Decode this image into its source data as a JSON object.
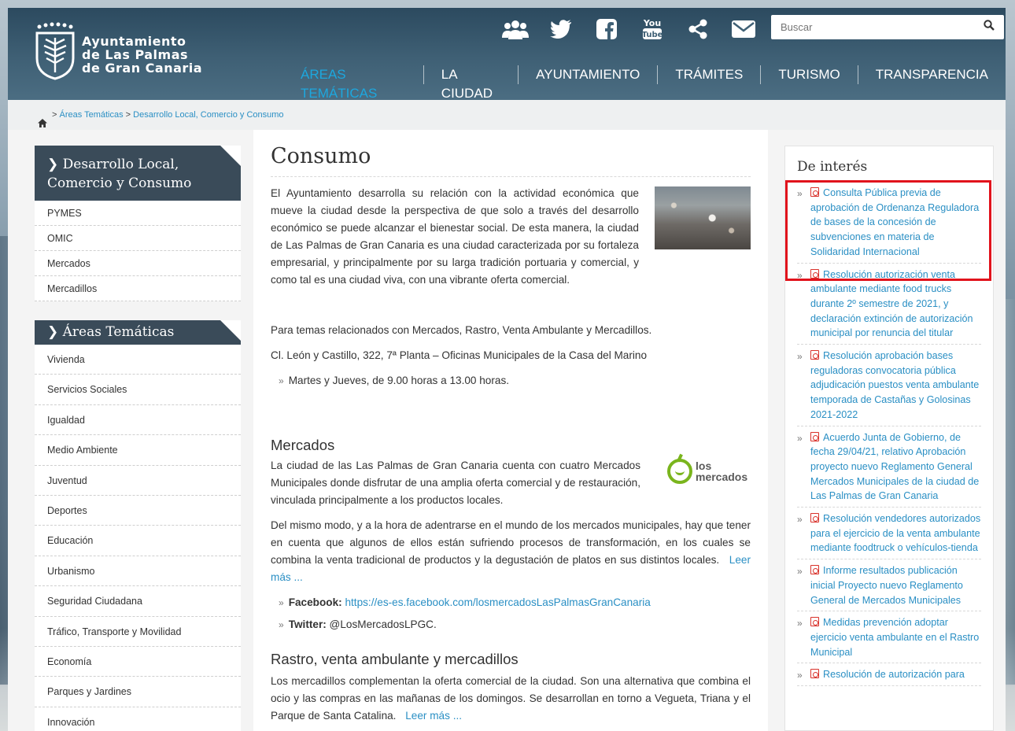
{
  "logo": {
    "lines": [
      "Ayuntamiento",
      "de Las Palmas",
      "de Gran Canaria"
    ]
  },
  "social_icons": [
    "people-icon",
    "twitter-icon",
    "facebook-icon",
    "youtube-icon",
    "share-icon",
    "mail-icon"
  ],
  "search": {
    "placeholder": "Buscar"
  },
  "nav": {
    "items": [
      "ÁREAS TEMÁTICAS",
      "LA CIUDAD",
      "AYUNTAMIENTO",
      "TRÁMITES",
      "TURISMO",
      "TRANSPARENCIA"
    ]
  },
  "breadcrumb": {
    "sep": ">",
    "items": [
      "Áreas Temáticas",
      "Desarrollo Local, Comercio y Consumo"
    ]
  },
  "left": {
    "section1": {
      "title_line1": "Desarrollo Local,",
      "title_line2": "Comercio y Consumo",
      "items": [
        "PYMES",
        "OMIC",
        "Mercados",
        "Mercadillos"
      ]
    },
    "section2": {
      "title": "Áreas Temáticas",
      "items": [
        "Vivienda",
        "Servicios Sociales",
        "Igualdad",
        "Medio Ambiente",
        "Juventud",
        "Deportes",
        "Educación",
        "Urbanismo",
        "Seguridad Ciudadana",
        "Tráfico, Transporte y Movilidad",
        "Economía",
        "Parques y Jardines",
        "Innovación"
      ]
    }
  },
  "content": {
    "title": "Consumo",
    "intro": "El Ayuntamiento desarrolla su relación con la actividad económica que mueve la ciudad desde la perspectiva de que solo a través del desarrollo económico se puede alcanzar el bienestar social. De esta manera, la ciudad de Las Palmas de Gran Canaria es una ciudad caracterizada por su fortaleza empresarial, y principalmente por su larga tradición portuaria y comercial, y como tal es una ciudad viva, con una vibrante oferta comercial.",
    "para2": "Para temas relacionados con Mercados, Rastro, Venta Ambulante y Mercadillos.",
    "address": "Cl. León y Castillo, 322, 7ª Planta – Oficinas Municipales de la Casa del Marino",
    "hours": "Martes y Jueves, de 9.00 horas a 13.00 horas.",
    "mercados": {
      "heading": "Mercados",
      "logo_line1": "los",
      "logo_line2": "mercados",
      "p1": "La ciudad de las Las Palmas de Gran Canaria cuenta con cuatro Mercados Municipales donde disfrutar de una amplia oferta comercial y de restauración, vinculada principalmente a los productos locales.",
      "p2": "Del mismo modo, y a la hora de adentrarse en el mundo de los mercados municipales, hay que tener en cuenta que algunos de ellos están sufriendo procesos de transformación, en los cuales se combina la venta tradicional de productos y la degustación de platos en sus distintos locales.",
      "more": "Leer más ...",
      "facebook_label": "Facebook:",
      "facebook_url": "https://es-es.facebook.com/losmercadosLasPalmasGranCanaria",
      "twitter_label": "Twitter:",
      "twitter_handle": "@LosMercadosLPGC."
    },
    "rastro": {
      "heading": "Rastro, venta ambulante y mercadillos",
      "p1": "Los mercadillos complementan la oferta comercial de la ciudad. Son una alternativa que combina el ocio y las compras en las mañanas de los domingos. Se desarrollan en torno a Vegueta, Triana y el Parque de Santa Catalina.",
      "more": "Leer más ..."
    }
  },
  "interest": {
    "title": "De interés",
    "items": [
      "Consulta Pública previa de aprobación de Ordenanza Reguladora de bases de la concesión de subvenciones en materia de Solidaridad Internacional",
      "Resolución autorización venta ambulante mediante food trucks durante 2º semestre de 2021, y declaración extinción de autorización municipal por renuncia del titular",
      "Resolución aprobación bases reguladoras convocatoria pública adjudicación puestos venta ambulante temporada de Castañas y Golosinas 2021-2022",
      "Acuerdo Junta de Gobierno, de fecha 29/04/21, relativo Aprobación proyecto nuevo Reglamento General Mercados Municipales de la ciudad de Las Palmas de Gran Canaria",
      "Resolución vendedores autorizados para el ejercicio de la venta ambulante mediante foodtruck o vehículos-tienda",
      "Informe resultados publicación inicial Proyecto nuevo Reglamento General de Mercados Municipales",
      "Medidas prevención adoptar ejercicio venta ambulante en el Rastro Municipal",
      "Resolución de autorización para"
    ]
  },
  "colors": {
    "header": "#3f6075",
    "accent": "#1da7de",
    "link": "#2a8fc4",
    "sidebar_head": "#3a4b59",
    "highlight": "#e1131c"
  }
}
